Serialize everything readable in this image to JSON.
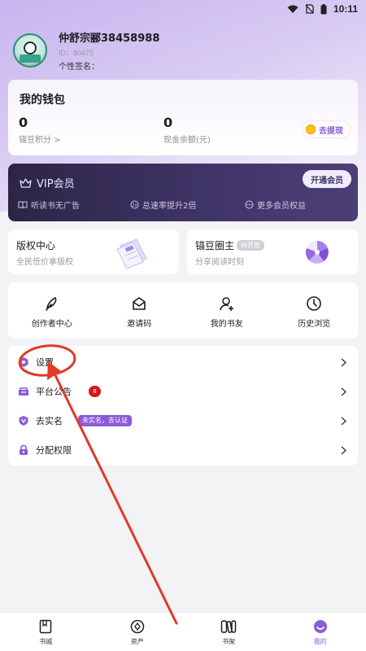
{
  "status_bar": {
    "time": "10:11"
  },
  "profile": {
    "username": "仲舒宗郦38458988",
    "uid": "ID：80475",
    "signature": "个性签名："
  },
  "wallet": {
    "title": "我的钱包",
    "points_value": "0",
    "points_label": "锚豆积分 >",
    "cash_value": "0",
    "cash_label": "现金余额(元)",
    "withdraw_label": "去提现"
  },
  "vip": {
    "title": "VIP会员",
    "button": "开通会员",
    "features": [
      "听读书无广告",
      "总速率提升2倍",
      "更多会员权益"
    ]
  },
  "copyright_card": {
    "title": "版权中心",
    "subtitle": "全民低价拿版权"
  },
  "circle_card": {
    "title": "锚豆圈主",
    "badge": "待开放",
    "subtitle": "分享阅读时刻"
  },
  "shortcuts": [
    {
      "label": "创作者中心",
      "icon": "pen-icon"
    },
    {
      "label": "邀请码",
      "icon": "envelope-icon"
    },
    {
      "label": "我的书友",
      "icon": "add-friend-icon"
    },
    {
      "label": "历史浏览",
      "icon": "clock-icon"
    }
  ],
  "menu": [
    {
      "label": "设置",
      "icon": "settings-icon"
    },
    {
      "label": "平台公告",
      "icon": "announcement-icon",
      "badge": "8"
    },
    {
      "label": "去实名",
      "icon": "verify-icon",
      "tag": "未实名，去认证"
    },
    {
      "label": "分配权限",
      "icon": "lock-icon"
    }
  ],
  "bottom_nav": [
    {
      "label": "书城",
      "icon": "bookstore-icon"
    },
    {
      "label": "资产",
      "icon": "assets-icon"
    },
    {
      "label": "书架",
      "icon": "bookshelf-icon"
    },
    {
      "label": "我的",
      "icon": "profile-icon",
      "active": true
    }
  ],
  "colors": {
    "accent": "#8a5cd6",
    "vip_bg": "#2c2546",
    "badge_red": "#d6181d",
    "annotation": "#e03a2a"
  }
}
